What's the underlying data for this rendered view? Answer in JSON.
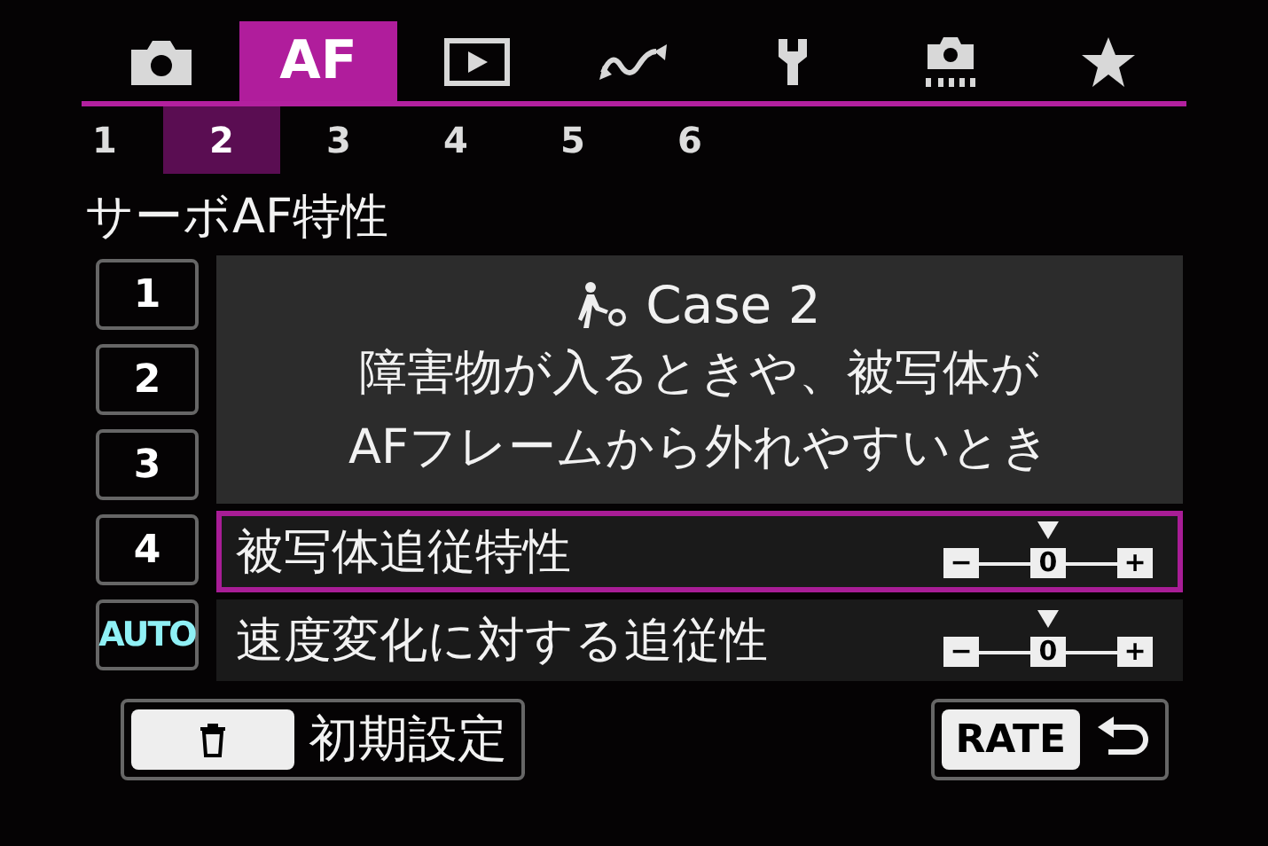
{
  "tabs": [
    {
      "kind": "camera",
      "selected": false
    },
    {
      "kind": "text",
      "label": "AF",
      "selected": true
    },
    {
      "kind": "play",
      "selected": false
    },
    {
      "kind": "wave",
      "selected": false
    },
    {
      "kind": "wrench",
      "selected": false
    },
    {
      "kind": "sensor",
      "selected": false
    },
    {
      "kind": "star",
      "selected": false
    }
  ],
  "subtabs": [
    {
      "label": "1",
      "selected": false
    },
    {
      "label": "2",
      "selected": true
    },
    {
      "label": "3",
      "selected": false
    },
    {
      "label": "4",
      "selected": false
    },
    {
      "label": "5",
      "selected": false
    },
    {
      "label": "6",
      "selected": false
    }
  ],
  "title": "サーボAF特性",
  "cases": [
    {
      "label": "1",
      "kind": "number"
    },
    {
      "label": "2",
      "kind": "number"
    },
    {
      "label": "3",
      "kind": "number"
    },
    {
      "label": "4",
      "kind": "number"
    },
    {
      "label": "AUTO",
      "kind": "auto"
    }
  ],
  "case_info": {
    "name": "Case 2",
    "description_lines": [
      "障害物が入るときや、被写体が",
      "AFフレームから外れやすいとき"
    ]
  },
  "parameters": [
    {
      "label": "被写体追従特性",
      "selected": true,
      "level": 0.5,
      "scale": [
        "−",
        "0",
        "+"
      ]
    },
    {
      "label": "速度変化に対する追従性",
      "selected": false,
      "level": 0.5,
      "scale": [
        "−",
        "0",
        "+"
      ]
    }
  ],
  "footer": {
    "reset_label": "初期設定",
    "rate_key": "RATE"
  }
}
